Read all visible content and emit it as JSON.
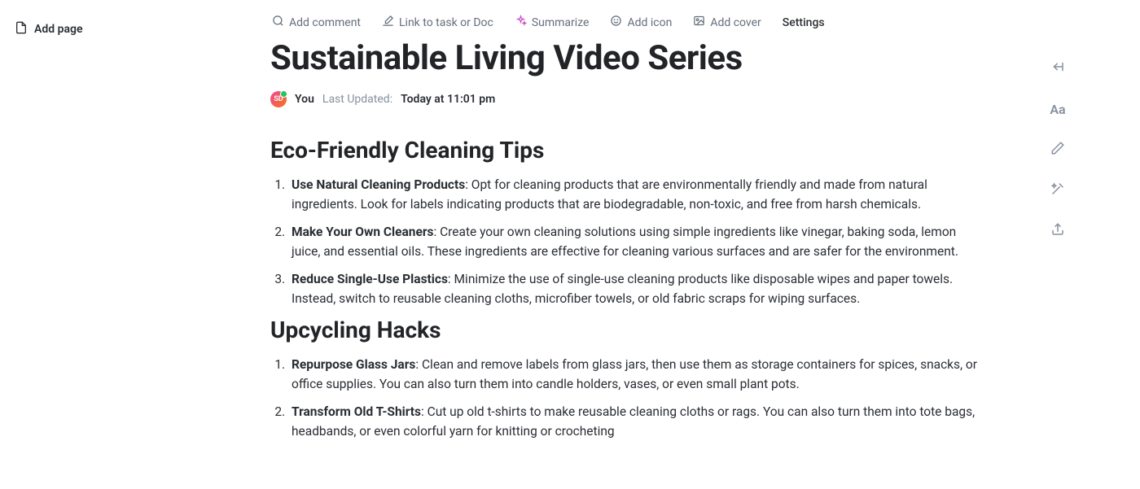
{
  "sidebar": {
    "add_page_label": "Add page"
  },
  "toolbar": {
    "add_comment": "Add comment",
    "link_doc": "Link to task or Doc",
    "summarize": "Summarize",
    "add_icon": "Add icon",
    "add_cover": "Add cover",
    "settings": "Settings"
  },
  "page": {
    "title": "Sustainable Living Video Series"
  },
  "meta": {
    "avatar_initials": "SD",
    "you_label": "You",
    "last_updated_label": "Last Updated:",
    "last_updated_value": "Today at 11:01 pm"
  },
  "sections": {
    "s1": {
      "heading": "Eco-Friendly Cleaning Tips",
      "items": [
        {
          "title": "Use Natural Cleaning Products",
          "body": ": Opt for cleaning products that are environmentally friendly and made from natural ingredients. Look for labels indicating products that are biodegradable, non-toxic, and free from harsh chemicals."
        },
        {
          "title": "Make Your Own Cleaners",
          "body": ": Create your own cleaning solutions using simple ingredients like vinegar, baking soda, lemon juice, and essential oils. These ingredients are effective for cleaning various surfaces and are safer for the environment."
        },
        {
          "title": "Reduce Single-Use Plastics",
          "body": ": Minimize the use of single-use cleaning products like disposable wipes and paper towels. Instead, switch to reusable cleaning cloths, microfiber towels, or old fabric scraps for wiping surfaces."
        }
      ]
    },
    "s2": {
      "heading": "Upcycling Hacks",
      "items": [
        {
          "title": "Repurpose Glass Jars",
          "body": ": Clean and remove labels from glass jars, then use them as storage containers for spices, snacks, or office supplies. You can also turn them into candle holders, vases, or even small plant pots."
        },
        {
          "title": "Transform Old T-Shirts",
          "body": ": Cut up old t-shirts to make reusable cleaning cloths or rags. You can also turn them into tote bags, headbands, or even colorful yarn for knitting or crocheting"
        }
      ]
    }
  }
}
